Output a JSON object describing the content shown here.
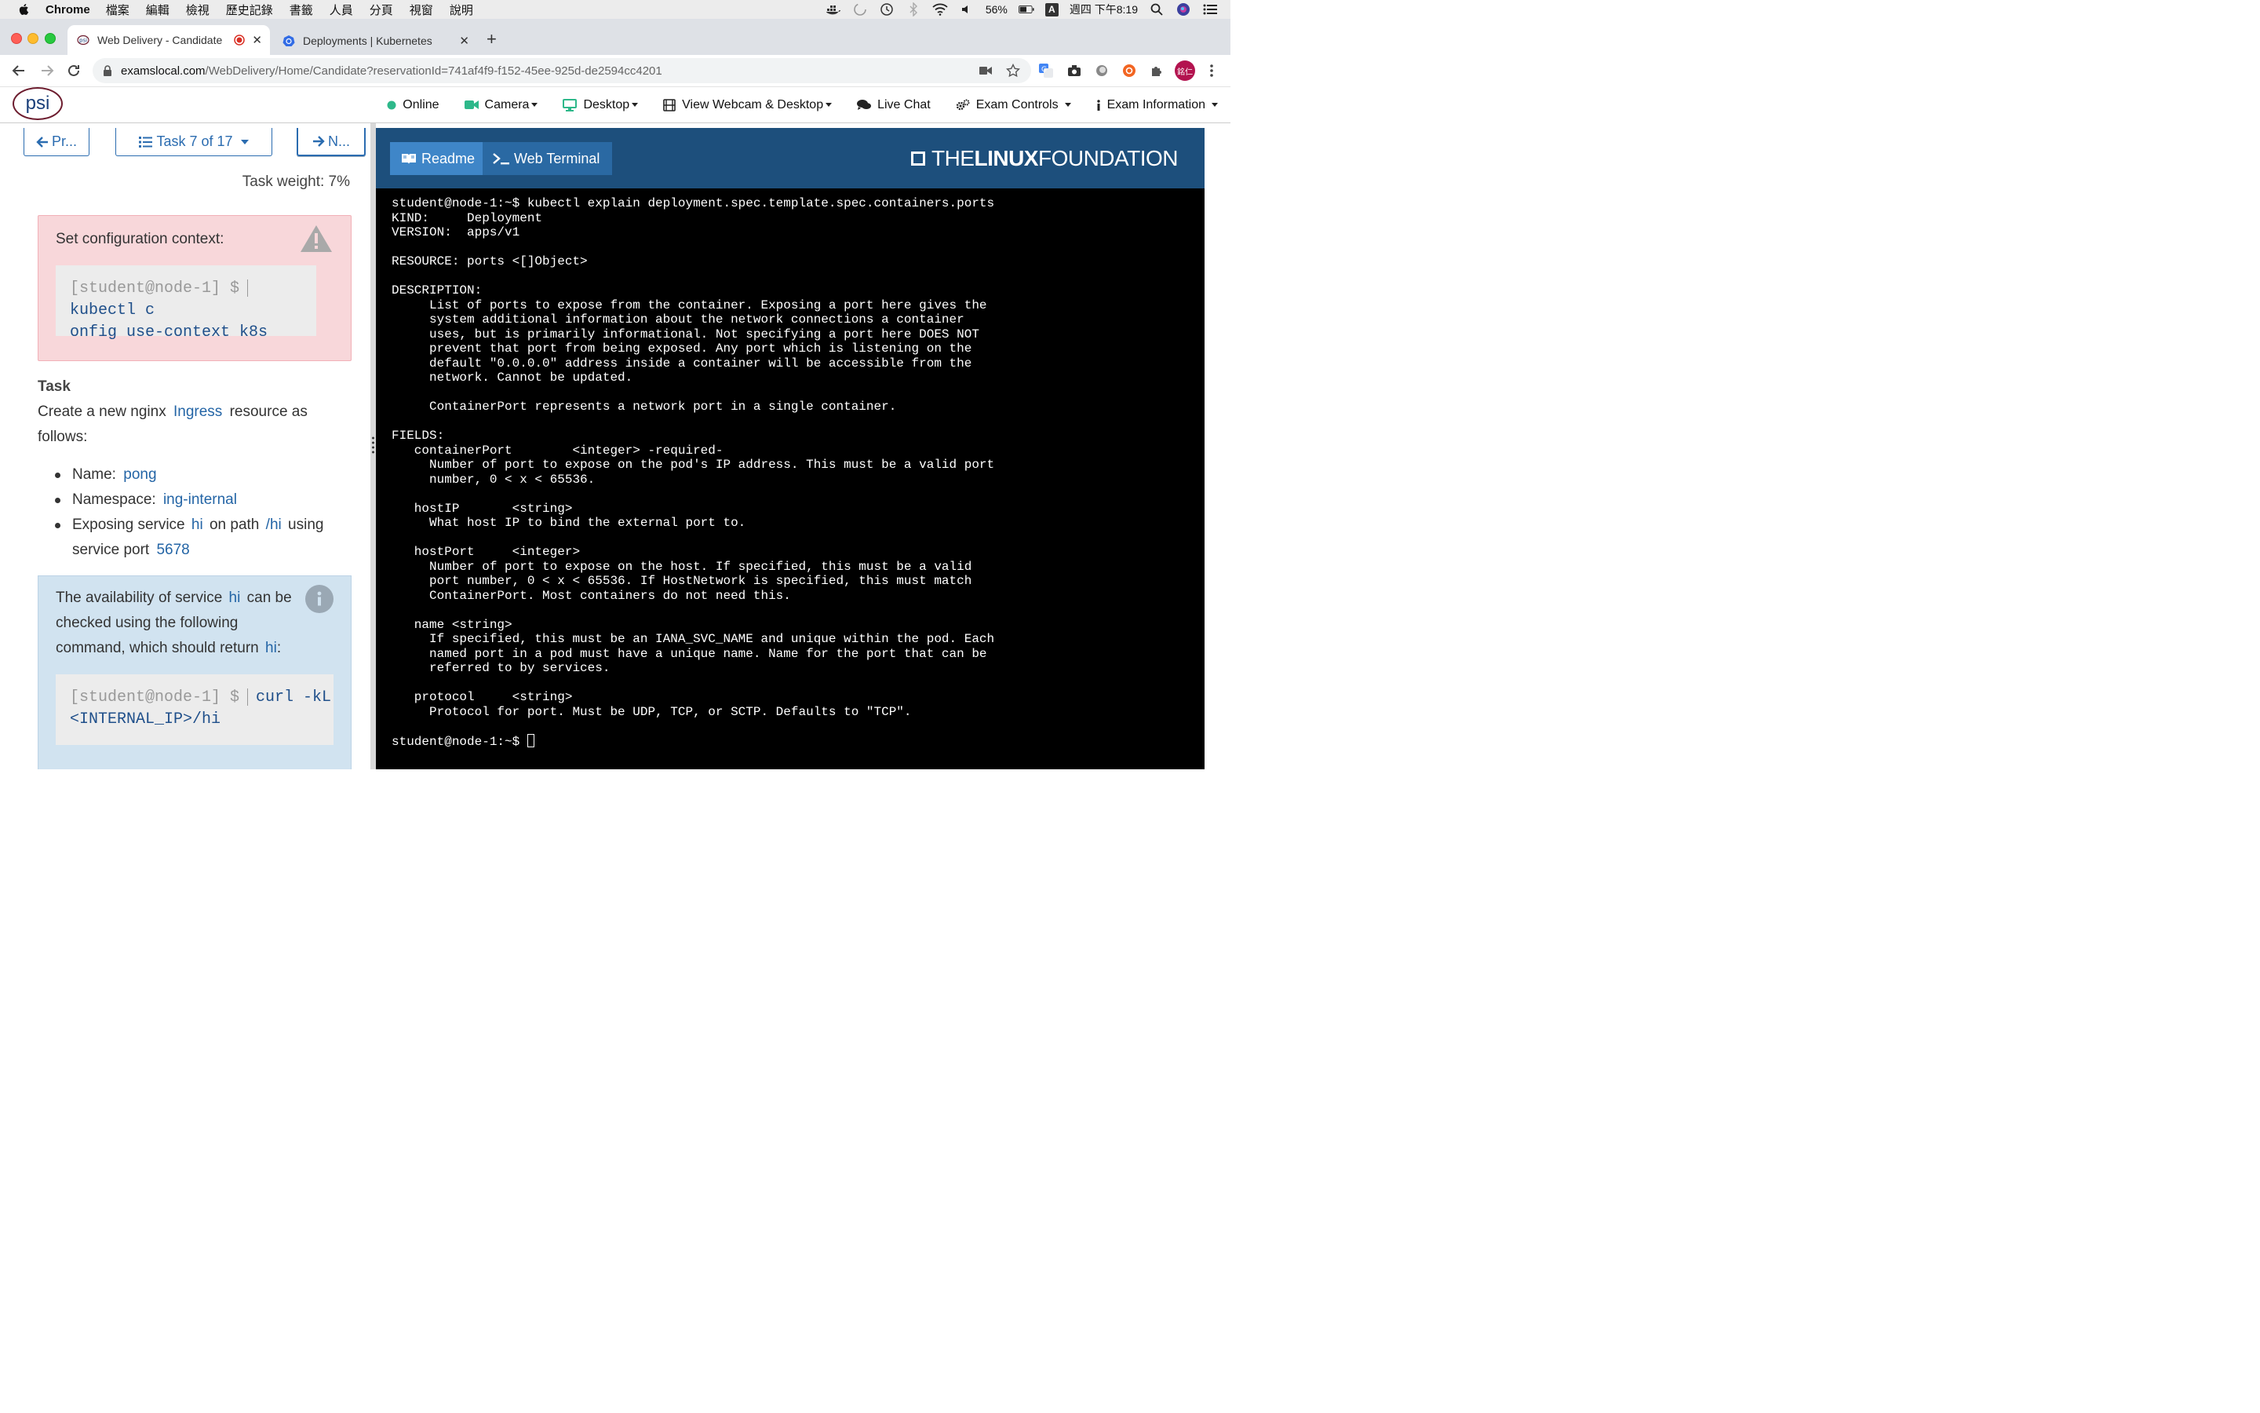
{
  "menubar": {
    "app": "Chrome",
    "items": [
      "檔案",
      "編輯",
      "檢視",
      "歷史記錄",
      "書籤",
      "人員",
      "分頁",
      "視窗",
      "說明"
    ],
    "battery": "56%",
    "input_letter": "A",
    "clock": "週四 下午8:19"
  },
  "tabs": [
    {
      "title": "Web Delivery - Candidate"
    },
    {
      "title": "Deployments | Kubernetes"
    }
  ],
  "address": {
    "domain": "examslocal.com",
    "path": "/WebDelivery/Home/Candidate?reservationId=741af4f9-f152-45ee-925d-de2594cc4201"
  },
  "profile_label": "銘仁",
  "psi": {
    "logo": "psi",
    "nav": {
      "online": "Online",
      "camera": "Camera",
      "desktop": "Desktop",
      "webcam": "View Webcam & Desktop",
      "chat": "Live Chat",
      "controls": "Exam Controls",
      "info": "Exam Information"
    }
  },
  "task": {
    "prev": "Pr...",
    "counter": "Task 7 of 17",
    "next": "N...",
    "weight": "Task weight: 7%",
    "context_label": "Set configuration context:",
    "context_prompt": "[student@node-1] $",
    "context_cmd_1": "kubectl c",
    "context_cmd_2": "onfig use-context k8s",
    "heading": "Task",
    "intro_1": "Create a new nginx",
    "intro_hl": "Ingress",
    "intro_2": "resource as follows:",
    "bullets": [
      {
        "label": "Name:",
        "value": "pong"
      },
      {
        "label": "Namespace:",
        "value": "ing-internal"
      }
    ],
    "b3_a": "Exposing service",
    "b3_svc": "hi",
    "b3_b": "on path",
    "b3_path": "/hi",
    "b3_c": "using service port",
    "b3_port": "5678",
    "info_a": "The availability of service",
    "info_svc": "hi",
    "info_b": "can be checked using the following command, which should return",
    "info_ret": "hi",
    "info_colon": ":",
    "info_prompt": "[student@node-1] $",
    "info_cmd_1": "curl -kL",
    "info_cmd_2": "<INTERNAL_IP>/hi"
  },
  "terminal": {
    "readme_tab": "Readme",
    "terminal_tab": "Web Terminal",
    "brand_thin": "THE",
    "brand_bold": "LINUX",
    "brand_end": "FOUNDATION",
    "output": "student@node-1:~$ kubectl explain deployment.spec.template.spec.containers.ports\nKIND:     Deployment\nVERSION:  apps/v1\n\nRESOURCE: ports <[]Object>\n\nDESCRIPTION:\n     List of ports to expose from the container. Exposing a port here gives the\n     system additional information about the network connections a container\n     uses, but is primarily informational. Not specifying a port here DOES NOT\n     prevent that port from being exposed. Any port which is listening on the\n     default \"0.0.0.0\" address inside a container will be accessible from the\n     network. Cannot be updated.\n\n     ContainerPort represents a network port in a single container.\n\nFIELDS:\n   containerPort        <integer> -required-\n     Number of port to expose on the pod's IP address. This must be a valid port\n     number, 0 < x < 65536.\n\n   hostIP       <string>\n     What host IP to bind the external port to.\n\n   hostPort     <integer>\n     Number of port to expose on the host. If specified, this must be a valid\n     port number, 0 < x < 65536. If HostNetwork is specified, this must match\n     ContainerPort. Most containers do not need this.\n\n   name <string>\n     If specified, this must be an IANA_SVC_NAME and unique within the pod. Each\n     named port in a pod must have a unique name. Name for the port that can be\n     referred to by services.\n\n   protocol     <string>\n     Protocol for port. Must be UDP, TCP, or SCTP. Defaults to \"TCP\".\n\n",
    "prompt": "student@node-1:~$ "
  },
  "colors": {
    "accent": "#2465a6",
    "alert_bg": "#f8d7da",
    "info_bg": "#d1e3f0",
    "lf_header": "#1d4f7c",
    "terminal_bg": "#000000"
  }
}
